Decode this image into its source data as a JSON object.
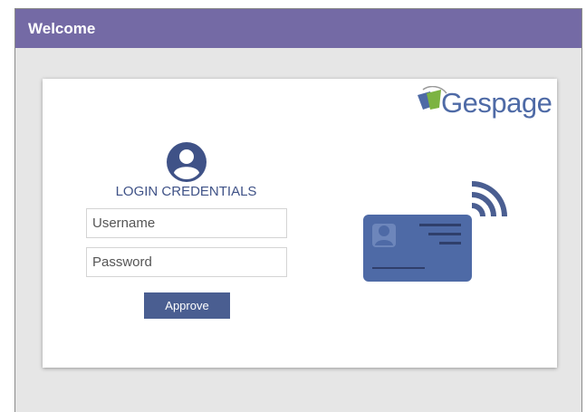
{
  "window": {
    "title": "Welcome"
  },
  "logo": {
    "text": "Gespage"
  },
  "login": {
    "title": "LOGIN CREDENTIALS",
    "username_placeholder": "Username",
    "password_placeholder": "Password",
    "approve_label": "Approve"
  },
  "colors": {
    "titlebar": "#746aa5",
    "accent": "#4a5e91",
    "user_icon": "#3f5287",
    "logo_green": "#7cb342"
  },
  "icons": {
    "user": "user-circle-icon",
    "card": "contactless-card-icon",
    "logo": "gespage-logo-icon"
  }
}
